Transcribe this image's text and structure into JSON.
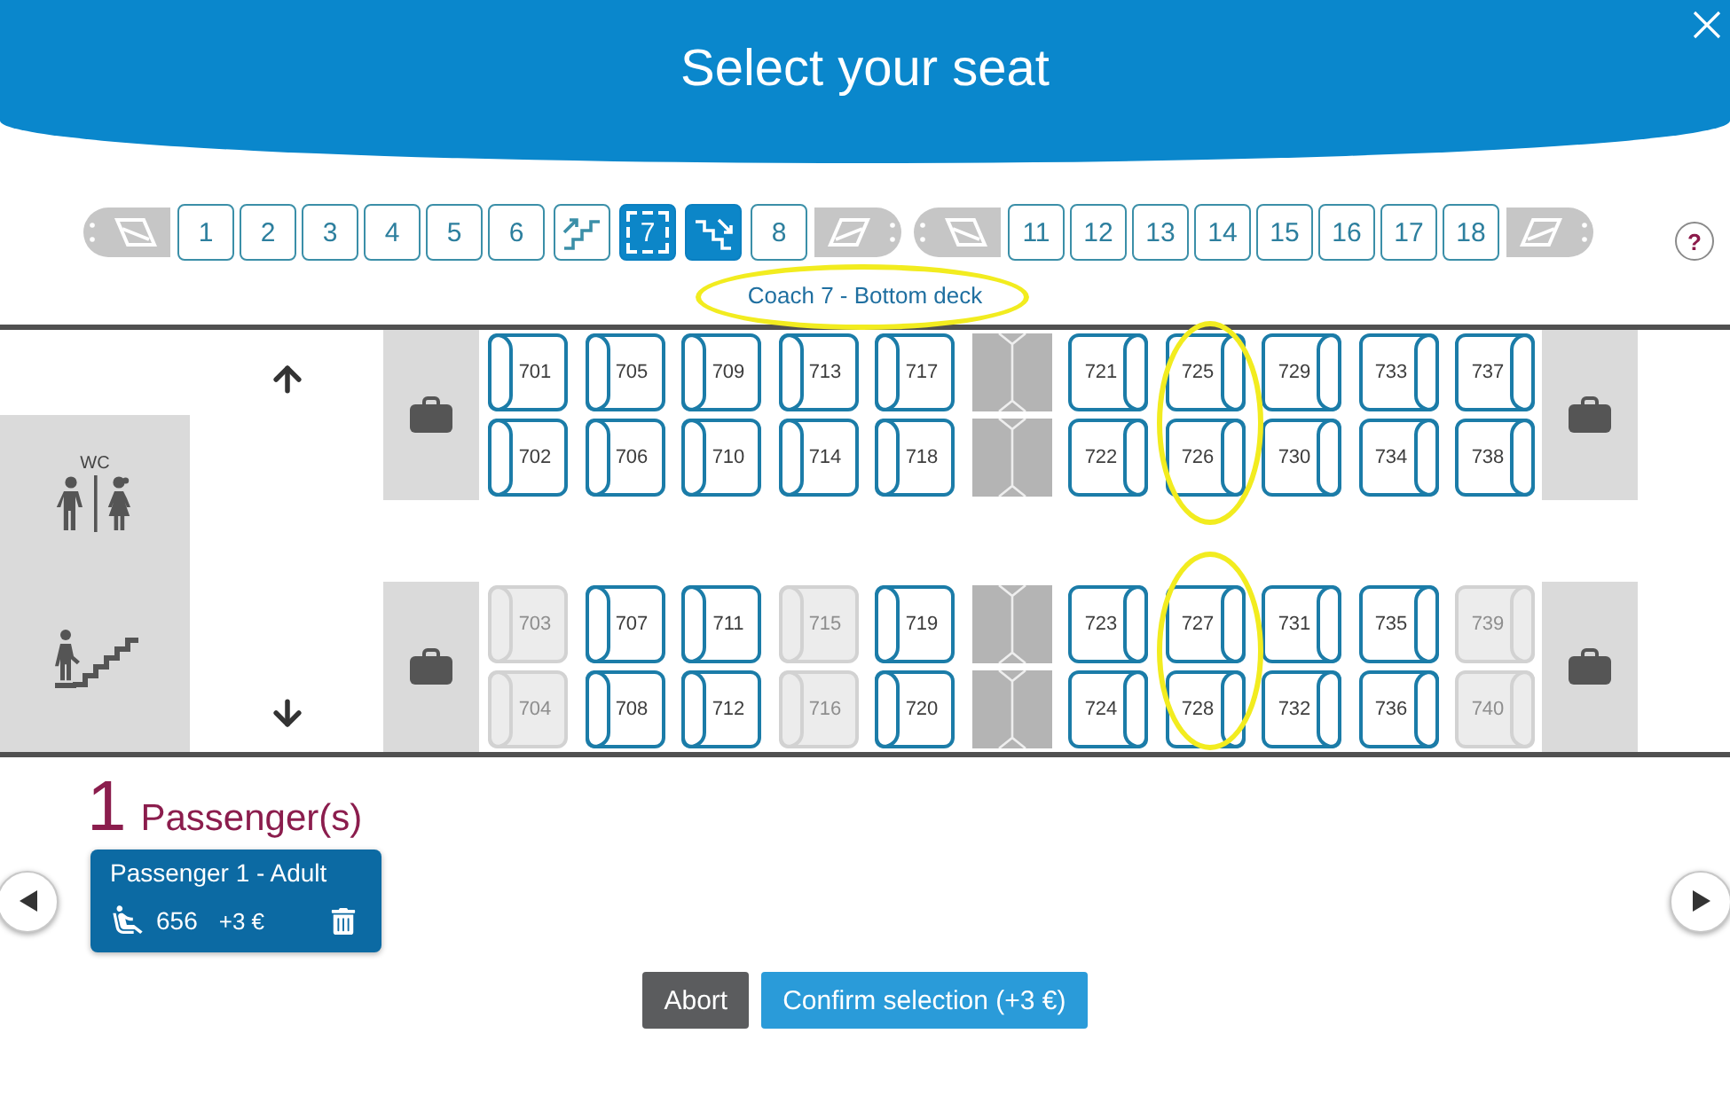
{
  "header": {
    "title": "Select your seat"
  },
  "coaches": [
    {
      "kind": "locomotive",
      "reversed": false
    },
    {
      "kind": "coach",
      "label": "1",
      "selected": false
    },
    {
      "kind": "coach",
      "label": "2",
      "selected": false
    },
    {
      "kind": "coach",
      "label": "3",
      "selected": false
    },
    {
      "kind": "coach",
      "label": "4",
      "selected": false
    },
    {
      "kind": "coach",
      "label": "5",
      "selected": false
    },
    {
      "kind": "coach",
      "label": "6",
      "selected": false
    },
    {
      "kind": "upstairs",
      "selected": false
    },
    {
      "kind": "coach",
      "label": "7",
      "selected": true
    },
    {
      "kind": "downstairs",
      "selected": true
    },
    {
      "kind": "coach",
      "label": "8",
      "selected": false
    },
    {
      "kind": "locomotive",
      "reversed": true
    },
    {
      "kind": "locomotive",
      "reversed": false
    },
    {
      "kind": "coach",
      "label": "11",
      "selected": false
    },
    {
      "kind": "coach",
      "label": "12",
      "selected": false
    },
    {
      "kind": "coach",
      "label": "13",
      "selected": false
    },
    {
      "kind": "coach",
      "label": "14",
      "selected": false
    },
    {
      "kind": "coach",
      "label": "15",
      "selected": false
    },
    {
      "kind": "coach",
      "label": "16",
      "selected": false
    },
    {
      "kind": "coach",
      "label": "17",
      "selected": false
    },
    {
      "kind": "coach",
      "label": "18",
      "selected": false
    },
    {
      "kind": "locomotive",
      "reversed": true
    }
  ],
  "help": "?",
  "coach_label": {
    "text": "Coach 7 - Bottom deck",
    "circled": true
  },
  "seat_map": {
    "wc_label": "WC",
    "blocks": [
      {
        "columns": [
          {
            "kind": "seats",
            "circled": false,
            "seats": [
              {
                "number": "701",
                "available": true,
                "backrest_right": false
              },
              {
                "number": "702",
                "available": true,
                "backrest_right": false
              }
            ]
          },
          {
            "kind": "seats",
            "circled": false,
            "seats": [
              {
                "number": "705",
                "available": true,
                "backrest_right": false
              },
              {
                "number": "706",
                "available": true,
                "backrest_right": false
              }
            ]
          },
          {
            "kind": "seats",
            "circled": false,
            "seats": [
              {
                "number": "709",
                "available": true,
                "backrest_right": false
              },
              {
                "number": "710",
                "available": true,
                "backrest_right": false
              }
            ]
          },
          {
            "kind": "seats",
            "circled": false,
            "seats": [
              {
                "number": "713",
                "available": true,
                "backrest_right": false
              },
              {
                "number": "714",
                "available": true,
                "backrest_right": false
              }
            ]
          },
          {
            "kind": "seats",
            "circled": false,
            "seats": [
              {
                "number": "717",
                "available": true,
                "backrest_right": false
              },
              {
                "number": "718",
                "available": true,
                "backrest_right": false
              }
            ]
          },
          {
            "kind": "table"
          },
          {
            "kind": "seats",
            "circled": false,
            "seats": [
              {
                "number": "721",
                "available": true,
                "backrest_right": true
              },
              {
                "number": "722",
                "available": true,
                "backrest_right": true
              }
            ]
          },
          {
            "kind": "seats",
            "circled": true,
            "seats": [
              {
                "number": "725",
                "available": true,
                "backrest_right": true
              },
              {
                "number": "726",
                "available": true,
                "backrest_right": true
              }
            ]
          },
          {
            "kind": "seats",
            "circled": false,
            "seats": [
              {
                "number": "729",
                "available": true,
                "backrest_right": true
              },
              {
                "number": "730",
                "available": true,
                "backrest_right": true
              }
            ]
          },
          {
            "kind": "seats",
            "circled": false,
            "seats": [
              {
                "number": "733",
                "available": true,
                "backrest_right": true
              },
              {
                "number": "734",
                "available": true,
                "backrest_right": true
              }
            ]
          },
          {
            "kind": "seats",
            "circled": false,
            "seats": [
              {
                "number": "737",
                "available": true,
                "backrest_right": true
              },
              {
                "number": "738",
                "available": true,
                "backrest_right": true
              }
            ]
          }
        ]
      },
      {
        "columns": [
          {
            "kind": "seats",
            "circled": false,
            "seats": [
              {
                "number": "703",
                "available": false,
                "backrest_right": false
              },
              {
                "number": "704",
                "available": false,
                "backrest_right": false
              }
            ]
          },
          {
            "kind": "seats",
            "circled": false,
            "seats": [
              {
                "number": "707",
                "available": true,
                "backrest_right": false
              },
              {
                "number": "708",
                "available": true,
                "backrest_right": false
              }
            ]
          },
          {
            "kind": "seats",
            "circled": false,
            "seats": [
              {
                "number": "711",
                "available": true,
                "backrest_right": false
              },
              {
                "number": "712",
                "available": true,
                "backrest_right": false
              }
            ]
          },
          {
            "kind": "seats",
            "circled": false,
            "seats": [
              {
                "number": "715",
                "available": false,
                "backrest_right": false
              },
              {
                "number": "716",
                "available": false,
                "backrest_right": false
              }
            ]
          },
          {
            "kind": "seats",
            "circled": false,
            "seats": [
              {
                "number": "719",
                "available": true,
                "backrest_right": false
              },
              {
                "number": "720",
                "available": true,
                "backrest_right": false
              }
            ]
          },
          {
            "kind": "table"
          },
          {
            "kind": "seats",
            "circled": false,
            "seats": [
              {
                "number": "723",
                "available": true,
                "backrest_right": true
              },
              {
                "number": "724",
                "available": true,
                "backrest_right": true
              }
            ]
          },
          {
            "kind": "seats",
            "circled": true,
            "seats": [
              {
                "number": "727",
                "available": true,
                "backrest_right": true
              },
              {
                "number": "728",
                "available": true,
                "backrest_right": true
              }
            ]
          },
          {
            "kind": "seats",
            "circled": false,
            "seats": [
              {
                "number": "731",
                "available": true,
                "backrest_right": true
              },
              {
                "number": "732",
                "available": true,
                "backrest_right": true
              }
            ]
          },
          {
            "kind": "seats",
            "circled": false,
            "seats": [
              {
                "number": "735",
                "available": true,
                "backrest_right": true
              },
              {
                "number": "736",
                "available": true,
                "backrest_right": true
              }
            ]
          },
          {
            "kind": "seats",
            "circled": false,
            "seats": [
              {
                "number": "739",
                "available": false,
                "backrest_right": true
              },
              {
                "number": "740",
                "available": false,
                "backrest_right": true
              }
            ]
          }
        ]
      }
    ]
  },
  "passengers": {
    "count": "1",
    "title": "Passenger(s)",
    "items": [
      {
        "name": "Passenger 1 - Adult",
        "seat": "656",
        "price": "+3 €"
      }
    ]
  },
  "actions": [
    {
      "kind": "secondary",
      "label": "Abort"
    },
    {
      "kind": "primary",
      "label": "Confirm selection (+3 €)"
    }
  ]
}
